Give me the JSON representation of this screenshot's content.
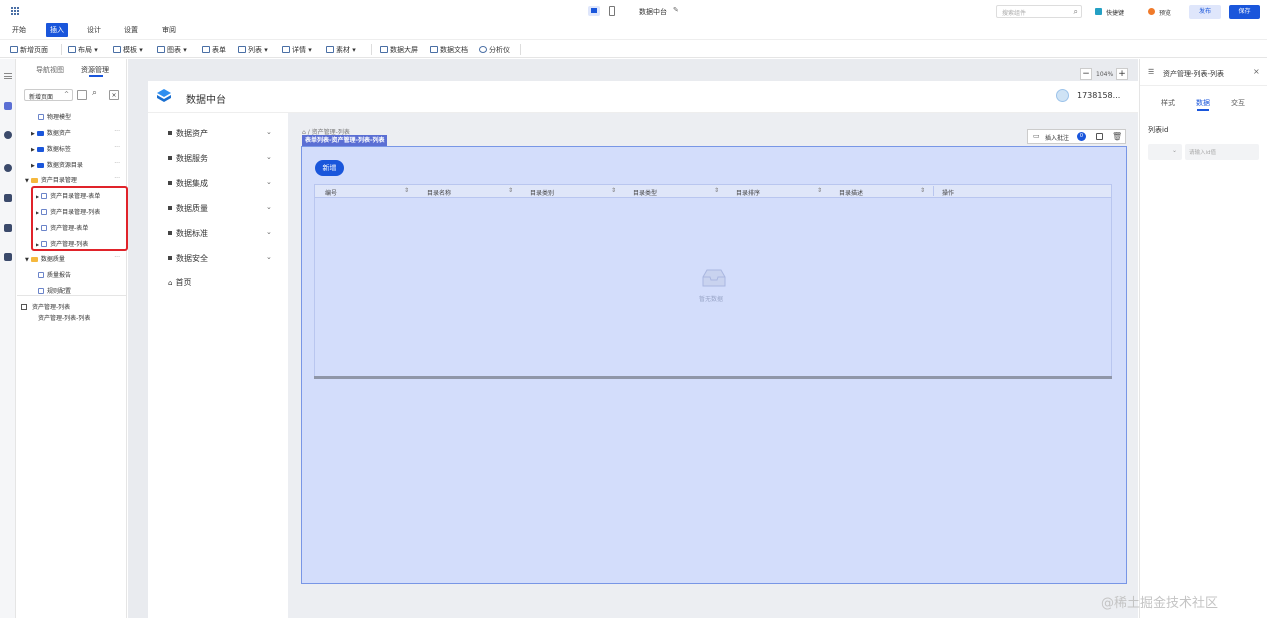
{
  "app": {
    "title": "数据中台",
    "search_placeholder": "搜索组件",
    "shortcut_label": "快捷键",
    "preview_label": "预览",
    "publish_label": "发布",
    "save_label": "保存"
  },
  "menu_tabs": [
    "开始",
    "插入",
    "设计",
    "设置",
    "审阅"
  ],
  "toolbar": [
    {
      "label": "新增页面"
    },
    {
      "label": "布局 ▾"
    },
    {
      "label": "模板 ▾"
    },
    {
      "label": "图表 ▾"
    },
    {
      "label": "表单"
    },
    {
      "label": "列表 ▾"
    },
    {
      "label": "详情 ▾"
    },
    {
      "label": "素材 ▾"
    },
    {
      "label": "数据大屏"
    },
    {
      "label": "数据文档"
    },
    {
      "label": "分析仪"
    }
  ],
  "left_panel": {
    "tabs": [
      "导航视图",
      "资源管理"
    ],
    "new_page_label": "新增页面",
    "new_page_arrow": "^",
    "tree": [
      {
        "label": "物理模型",
        "kind": "page",
        "indent": 0
      },
      {
        "label": "数据资产",
        "kind": "folder",
        "indent": 0
      },
      {
        "label": "数据标签",
        "kind": "folder",
        "indent": 0
      },
      {
        "label": "数据资源目录",
        "kind": "folder",
        "indent": 0
      },
      {
        "label": "资产目录管理",
        "kind": "folder-open",
        "indent": 0
      },
      {
        "label": "资产目录管理-表单",
        "kind": "page",
        "indent": 1
      },
      {
        "label": "资产目录管理-列表",
        "kind": "page",
        "indent": 1
      },
      {
        "label": "资产管理-表单",
        "kind": "page",
        "indent": 1
      },
      {
        "label": "资产管理-列表",
        "kind": "page",
        "indent": 1
      },
      {
        "label": "数据质量",
        "kind": "folder-open",
        "indent": 0
      },
      {
        "label": "质量报告",
        "kind": "page",
        "indent": 1
      },
      {
        "label": "规则配置",
        "kind": "page",
        "indent": 1
      }
    ],
    "outline_title": "资产管理-列表",
    "outline_child": "资产管理-列表-列表"
  },
  "canvas": {
    "zoom": "104%",
    "page_title": "数据中台",
    "user": "1738158...",
    "nav": [
      "数据资产",
      "数据服务",
      "数据集成",
      "数据质量",
      "数据标准",
      "数据安全",
      "首页"
    ],
    "breadcrumb": "资产管理-列表",
    "selected_label": "表单列表-资产管理-列表-列表",
    "insert_note_label": "插入批注",
    "note_count": "0",
    "add_button": "新增",
    "columns": [
      "编号",
      "目录名称",
      "目录类别",
      "目录类型",
      "目录排序",
      "目录描述",
      "操作"
    ],
    "empty_text": "暂无数据"
  },
  "right_panel": {
    "title": "资产管理-列表-列表",
    "tabs": [
      "样式",
      "数据",
      "交互"
    ],
    "field_label": "列表id",
    "field_placeholder": "请输入id值"
  },
  "colors": {
    "accent": "#1a56db",
    "selection_fill": "#d3ddfb",
    "selection_border": "#7896e6",
    "selected_tag": "#5b6fd4",
    "highlight_red": "#e0232a"
  },
  "watermark": "@稀土掘金技术社区"
}
